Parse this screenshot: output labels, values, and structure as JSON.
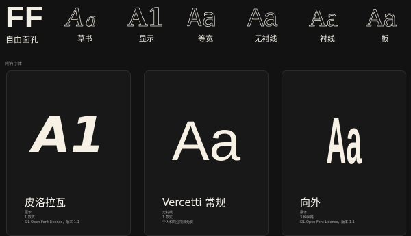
{
  "logo": {
    "mark": "FF",
    "label": "自由面孔"
  },
  "categories": [
    {
      "label": "草书",
      "icon": "script-aa-icon"
    },
    {
      "label": "显示",
      "icon": "display-a1-icon"
    },
    {
      "label": "等宽",
      "icon": "monospace-aa-icon"
    },
    {
      "label": "无衬线",
      "icon": "sans-serif-aa-icon"
    },
    {
      "label": "衬线",
      "icon": "serif-aa-icon"
    },
    {
      "label": "板",
      "icon": "slab-aa-icon"
    }
  ],
  "section": {
    "label": "所有字体"
  },
  "cards": [
    {
      "preview": "A1",
      "name": "皮洛拉瓦",
      "meta": [
        "展示",
        "1 款式",
        "SIL Open Font License，版本 1.1"
      ]
    },
    {
      "preview": "Aa",
      "name": "Vercetti 常规",
      "meta": [
        "无衬线",
        "1 款式",
        "个人和商业项目免费"
      ]
    },
    {
      "preview": "Aa",
      "name": "向外",
      "meta": [
        "展示",
        "3 种风格",
        "SIL Open Font License，版本 1.1"
      ]
    }
  ],
  "colors": {
    "background": "#121212",
    "card": "#181818",
    "text": "#f2efe6",
    "muted": "#a6a6a6"
  }
}
